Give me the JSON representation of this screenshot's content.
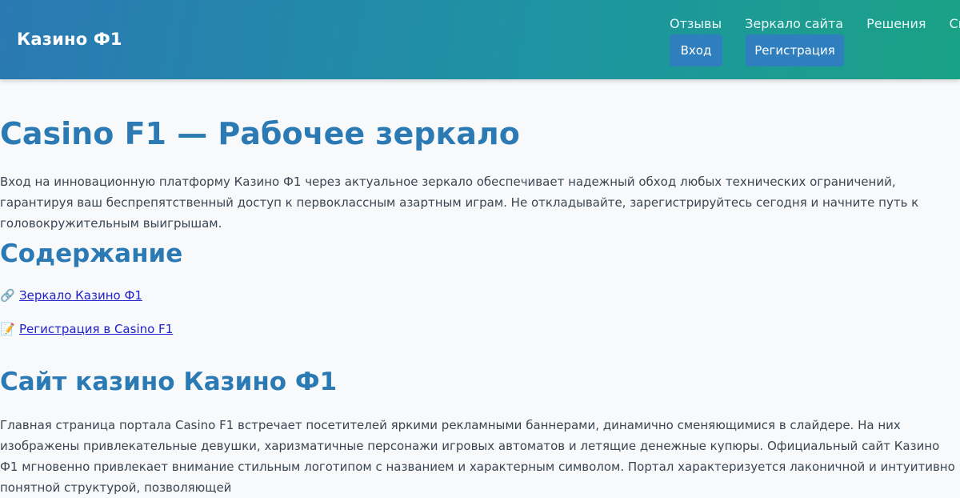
{
  "header": {
    "logo": "Казино Ф1",
    "nav": [
      "Отзывы",
      "Зеркало сайта",
      "Решения",
      "Связаться"
    ],
    "login_label": "Вход",
    "register_label": "Регистрация"
  },
  "main": {
    "title": "Casino F1 — Рабочее зеркало",
    "intro": "Вход на инновационную платформу Казино Ф1 через актуальное зеркало обеспечивает надежный обход любых технических ограничений, гарантируя ваш беспрепятственный доступ к первоклассным азартным играм. Не откладывайте, зарегистрируйтесь сегодня и начните путь к головокружительным выигрышам.",
    "toc_title": "Содержание",
    "toc": [
      {
        "icon": "🔗",
        "label": "Зеркало Казино Ф1"
      },
      {
        "icon": "📝",
        "label": "Регистрация в Casino F1"
      }
    ],
    "section_title": "Сайт казино Казино Ф1",
    "section_text": "Главная страница портала Casino F1 встречает посетителей яркими рекламными баннерами, динамично сменяющимися в слайдере. На них изображены привлекательные девушки, харизматичные персонажи игровых автоматов и летящие денежные купюры. Официальный сайт Казино Ф1 мгновенно привлекает внимание стильным логотипом с названием и характерным символом. Портал характеризуется лаконичной и интуитивно понятной структурой, позволяющей"
  }
}
